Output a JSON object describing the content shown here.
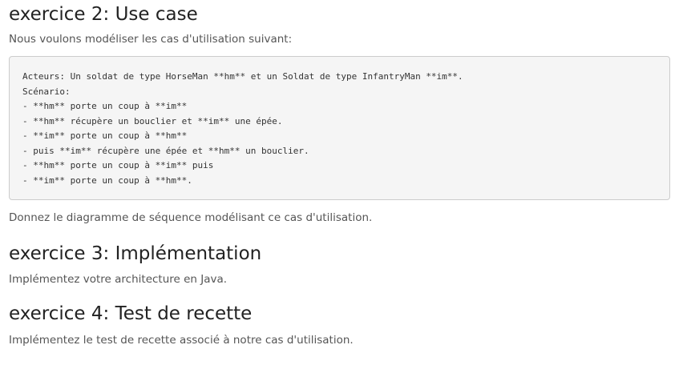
{
  "exercise2": {
    "title": "exercice 2: Use case",
    "intro": "Nous voulons modéliser les cas d'utilisation suivant:",
    "code_lines": [
      "Acteurs: Un soldat de type HorseMan **hm** et un Soldat de type InfantryMan **im**.",
      "Scénario:",
      "- **hm** porte un coup à **im**",
      "- **hm** récupère un bouclier et **im** une épée.",
      "- **im** porte un coup à **hm**",
      "- puis **im** récupère une épée et **hm** un bouclier.",
      "- **hm** porte un coup à **im** puis",
      "- **im** porte un coup à **hm**."
    ],
    "question": "Donnez le diagramme de séquence modélisant ce cas d'utilisation."
  },
  "exercise3": {
    "title": "exercice 3: Implémentation",
    "text": "Implémentez votre architecture en Java."
  },
  "exercise4": {
    "title": "exercice 4: Test de recette",
    "text": "Implémentez le test de recette associé à notre cas d'utilisation."
  }
}
